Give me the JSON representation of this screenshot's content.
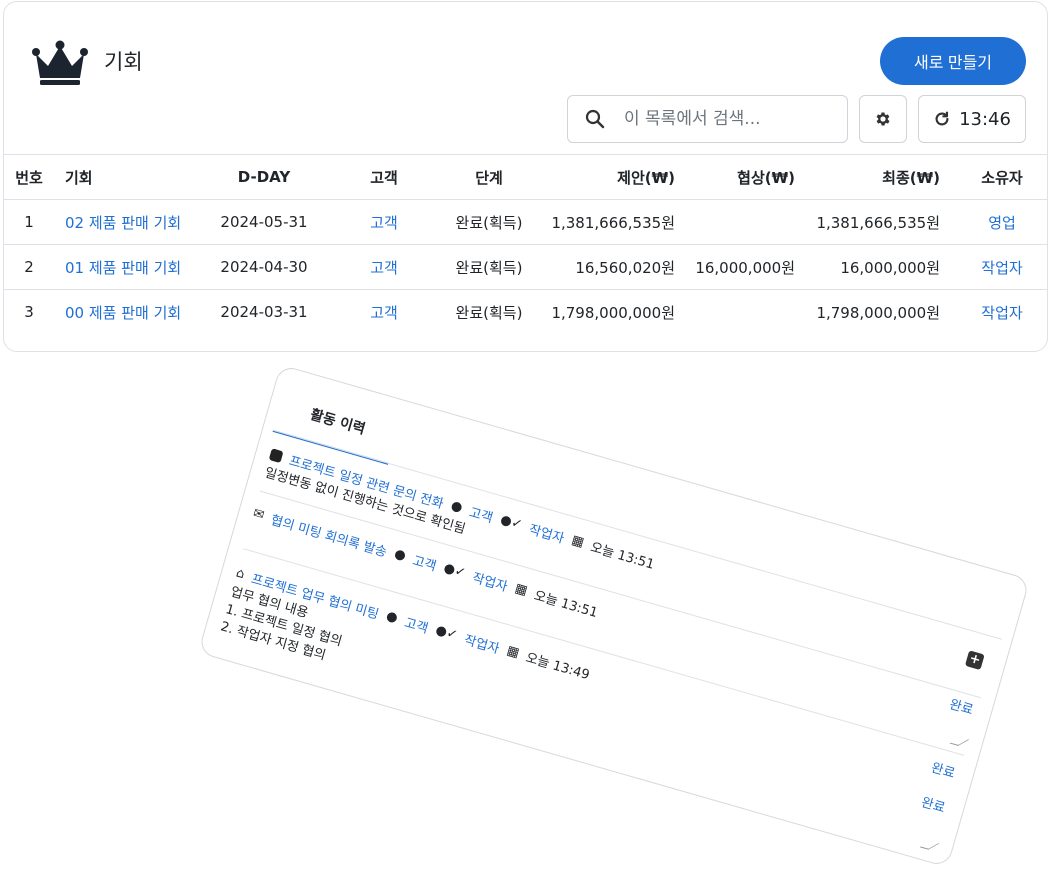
{
  "header": {
    "title": "기회",
    "new_button": "새로 만들기",
    "search_placeholder": "이 목록에서 검색...",
    "refresh_time": "13:46"
  },
  "table": {
    "columns": [
      "번호",
      "기회",
      "D-DAY",
      "고객",
      "단계",
      "제안(₩)",
      "협상(₩)",
      "최종(₩)",
      "소유자"
    ],
    "rows": [
      {
        "no": "1",
        "name": "02 제품 판매 기회",
        "dday": "2024-05-31",
        "customer": "고객",
        "stage": "완료(획득)",
        "proposal": "1,381,666,535원",
        "negotiation": "",
        "final": "1,381,666,535원",
        "owner": "영업"
      },
      {
        "no": "2",
        "name": "01 제품 판매 기회",
        "dday": "2024-04-30",
        "customer": "고객",
        "stage": "완료(획득)",
        "proposal": "16,560,020원",
        "negotiation": "16,000,000원",
        "final": "16,000,000원",
        "owner": "작업자"
      },
      {
        "no": "3",
        "name": "00 제품 판매 기회",
        "dday": "2024-03-31",
        "customer": "고객",
        "stage": "완료(획득)",
        "proposal": "1,798,000,000원",
        "negotiation": "",
        "final": "1,798,000,000원",
        "owner": "작업자"
      }
    ]
  },
  "activity": {
    "tab": "활동 이력",
    "items": [
      {
        "icon": "phone-icon",
        "title": "프로젝트 일정 관련 문의 전화",
        "customer": "고객",
        "owner": "작업자",
        "time": "오늘 13:51",
        "body": "일정변동 없이 진행하는 것으로 확인됨"
      },
      {
        "icon": "mail-icon",
        "title": "협의 미팅 회의록 발송",
        "customer": "고객",
        "owner": "작업자",
        "time": "오늘 13:51",
        "body": ""
      },
      {
        "icon": "meeting-icon",
        "title": "프로젝트 업무 협의 미팅",
        "customer": "고객",
        "owner": "작업자",
        "time": "오늘 13:49",
        "body": "업무 협의 내용\n1. 프로젝트 일정 협의\n2. 작업자 지정 협의"
      }
    ],
    "done_label": "완료"
  },
  "colors": {
    "accent": "#1f6fd4",
    "border": "#dee2e6"
  }
}
